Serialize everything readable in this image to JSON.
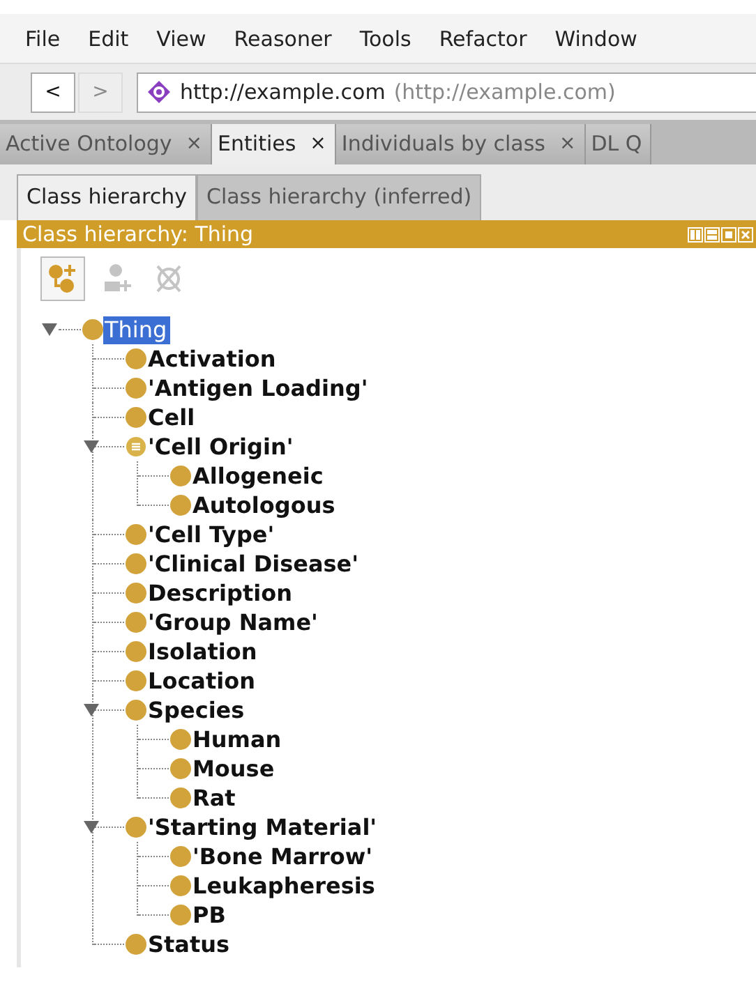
{
  "menu": [
    "File",
    "Edit",
    "View",
    "Reasoner",
    "Tools",
    "Refactor",
    "Window"
  ],
  "navigation": {
    "back": {
      "label": "<",
      "disabled": false
    },
    "forward": {
      "label": ">",
      "disabled": true
    },
    "address": "http://example.com",
    "address_hint": "(http://example.com)"
  },
  "tabs": [
    {
      "label": "Active Ontology",
      "close": "×",
      "selected": false
    },
    {
      "label": "Entities",
      "close": "×",
      "selected": true
    },
    {
      "label": "Individuals by class",
      "close": "×",
      "selected": false
    },
    {
      "label": "DL Q",
      "selected": false
    }
  ],
  "subtabs": [
    {
      "label": "Class hierarchy",
      "selected": true
    },
    {
      "label": "Class hierarchy (inferred)",
      "selected": false
    }
  ],
  "view_title": "Class hierarchy: Thing",
  "toolbar": [
    {
      "kind": "add-subclass",
      "disabled": false
    },
    {
      "kind": "add-sibling",
      "disabled": true
    },
    {
      "kind": "delete",
      "disabled": true
    }
  ],
  "tree": [
    {
      "label": "Thing",
      "kind": "root",
      "selected": true,
      "expanded": true,
      "children": [
        {
          "label": "Activation",
          "kind": "class",
          "selected": false
        },
        {
          "label": "'Antigen Loading'",
          "kind": "class",
          "selected": false
        },
        {
          "label": "Cell",
          "kind": "class",
          "selected": false
        },
        {
          "label": "'Cell Origin'",
          "kind": "defined",
          "selected": false,
          "expanded": true,
          "children": [
            {
              "label": "Allogeneic",
              "kind": "class",
              "selected": false
            },
            {
              "label": "Autologous",
              "kind": "class",
              "selected": false
            }
          ]
        },
        {
          "label": "'Cell Type'",
          "kind": "class",
          "selected": false
        },
        {
          "label": "'Clinical Disease'",
          "kind": "class",
          "selected": false
        },
        {
          "label": "Description",
          "kind": "class",
          "selected": false
        },
        {
          "label": "'Group Name'",
          "kind": "class",
          "selected": false
        },
        {
          "label": "Isolation",
          "kind": "class",
          "selected": false
        },
        {
          "label": "Location",
          "kind": "class",
          "selected": false
        },
        {
          "label": "Species",
          "kind": "class",
          "selected": false,
          "expanded": true,
          "children": [
            {
              "label": "Human",
              "kind": "class",
              "selected": false
            },
            {
              "label": "Mouse",
              "kind": "class",
              "selected": false
            },
            {
              "label": "Rat",
              "kind": "class",
              "selected": false
            }
          ]
        },
        {
          "label": "'Starting Material'",
          "kind": "class",
          "selected": false,
          "expanded": true,
          "children": [
            {
              "label": "'Bone Marrow'",
              "kind": "class",
              "selected": false
            },
            {
              "label": "Leukapheresis",
              "kind": "class",
              "selected": false
            },
            {
              "label": "PB",
              "kind": "class",
              "selected": false
            }
          ]
        },
        {
          "label": "Status",
          "kind": "class",
          "selected": false
        }
      ]
    }
  ]
}
